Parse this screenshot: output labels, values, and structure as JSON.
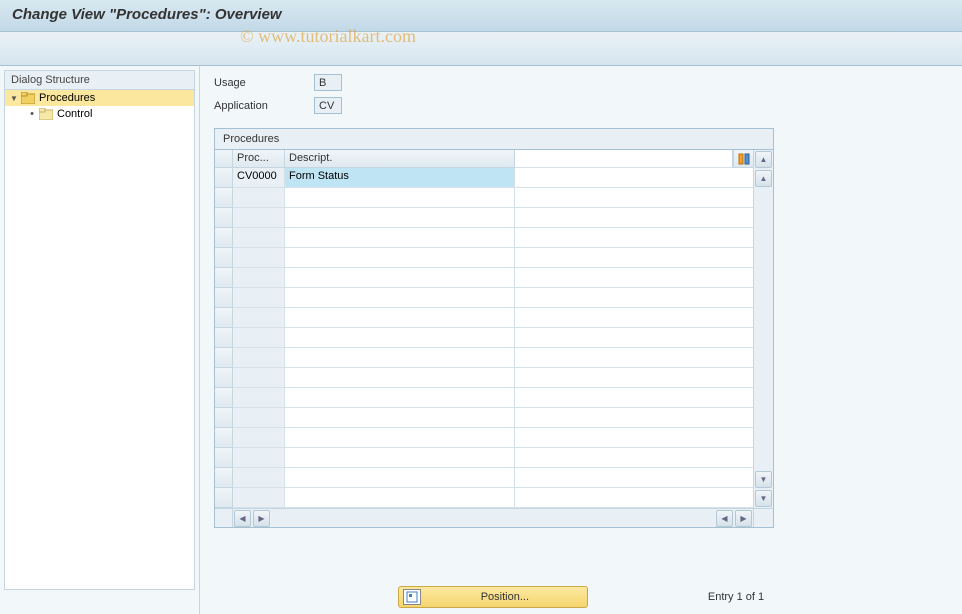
{
  "title": "Change View \"Procedures\": Overview",
  "watermark": "© www.tutorialkart.com",
  "sidebar": {
    "header": "Dialog Structure",
    "items": [
      {
        "label": "Procedures",
        "selected": true,
        "open": true
      },
      {
        "label": "Control",
        "selected": false,
        "open": false
      }
    ]
  },
  "fields": {
    "usage_label": "Usage",
    "usage_value": "B",
    "application_label": "Application",
    "application_value": "CV"
  },
  "table": {
    "title": "Procedures",
    "columns": {
      "proc": "Proc...",
      "desc": "Descript."
    },
    "rows": [
      {
        "proc": "CV0000",
        "desc": "Form Status"
      }
    ],
    "empty_rows": 16
  },
  "footer": {
    "position_btn": "Position...",
    "entry_text": "Entry 1 of 1"
  }
}
